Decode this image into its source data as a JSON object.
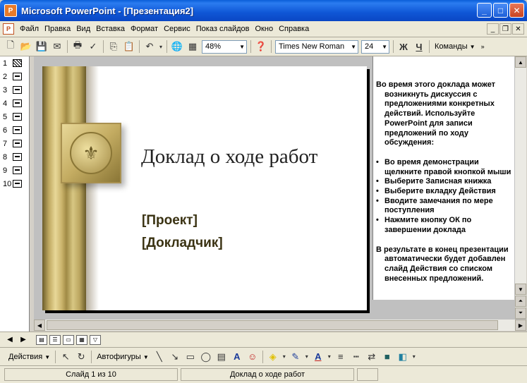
{
  "window": {
    "title": "Microsoft PowerPoint - [Презентация2]"
  },
  "menu": {
    "items": [
      {
        "label": "Файл",
        "id": "file"
      },
      {
        "label": "Правка",
        "id": "edit"
      },
      {
        "label": "Вид",
        "id": "view"
      },
      {
        "label": "Вставка",
        "id": "insert"
      },
      {
        "label": "Формат",
        "id": "format"
      },
      {
        "label": "Сервис",
        "id": "tools"
      },
      {
        "label": "Показ слайдов",
        "id": "slideshow"
      },
      {
        "label": "Окно",
        "id": "window"
      },
      {
        "label": "Справка",
        "id": "help"
      }
    ]
  },
  "toolbar": {
    "zoom": "48%",
    "font_name": "Times New Roman",
    "font_size": "24",
    "bold": "Ж",
    "underline": "Ч",
    "commands": "Команды"
  },
  "outline": {
    "slides": [
      "1",
      "2",
      "3",
      "4",
      "5",
      "6",
      "7",
      "8",
      "9",
      "10"
    ]
  },
  "slide": {
    "title": "Доклад о ходе работ",
    "project": "[Проект]",
    "speaker": "[Докладчик]"
  },
  "notes": {
    "intro_first": "Во время этого доклада может",
    "intro_rest": "возникнуть дискуссия с предложениями конкретных действий. Используйте PowerPoint для записи предложений по ходу обсуждения:",
    "bullets": [
      "Во время демонстрации щелкните правой кнопкой мыши",
      "Выберите Записная книжка",
      "Выберите вкладку Действия",
      "Вводите замечания по мере поступления",
      "Нажмите кнопку ОК по завершении доклада"
    ],
    "after_first": "В результате в конец презентации",
    "after_rest": "автоматически будет добавлен слайд Действия со списком внесенных предложений."
  },
  "drawing": {
    "actions": "Действия",
    "autoshapes": "Автофигуры"
  },
  "status": {
    "slide": "Слайд 1 из 10",
    "design": "Доклад о ходе работ"
  }
}
